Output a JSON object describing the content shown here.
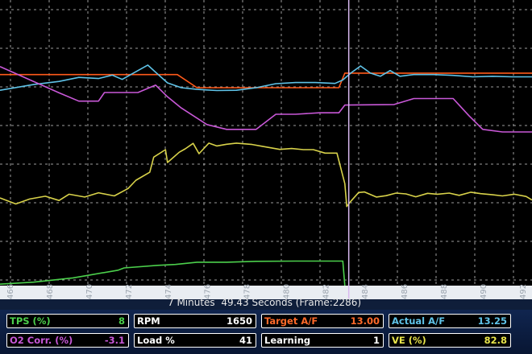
{
  "status": {
    "frame_text": "7 Minutes  49.43 Seconds (Frame:2286)"
  },
  "x_axis": {
    "ticks": [
      "466",
      "468",
      "470",
      "472",
      "474",
      "476",
      "478",
      "480",
      "482",
      "484",
      "486",
      "488",
      "490",
      "492"
    ]
  },
  "cursor": {
    "x": 483.2
  },
  "colors": {
    "background": "#000000",
    "grid": "#cfcfcf",
    "target_af": "#ff5a1a",
    "actual_af": "#5fc3e8",
    "rpm": "#c958d8",
    "load": "#d8d24a",
    "tps": "#4cd04c",
    "cursor": "#d9b9f0"
  },
  "gauges": {
    "rows": [
      [
        {
          "label": "TPS (%)",
          "value": "8",
          "color": "#4cd04c"
        },
        {
          "label": "RPM",
          "value": "1650",
          "color": "#ffffff"
        },
        {
          "label": "Target A/F",
          "value": "13.00",
          "color": "#ff6a2a"
        },
        {
          "label": "Actual A/F",
          "value": "13.25",
          "color": "#5fc3e8"
        }
      ],
      [
        {
          "label": "O2 Corr. (%)",
          "value": "-3.1",
          "color": "#c958d8"
        },
        {
          "label": "Load %",
          "value": "41",
          "color": "#ffffff"
        },
        {
          "label": "Learning",
          "value": "1",
          "color": "#ffffff"
        },
        {
          "label": "VE (%)",
          "value": "82.8",
          "color": "#e8e44a"
        }
      ]
    ]
  },
  "chart_data": {
    "type": "line",
    "x_range": [
      465.5,
      492.5
    ],
    "y_range": [
      0,
      100
    ],
    "grid": true,
    "series": [
      {
        "key": "target_af",
        "color": "#ff5a1a",
        "points": [
          [
            465.5,
            73.9
          ],
          [
            474.5,
            73.9
          ],
          [
            475.5,
            69.3
          ],
          [
            482.7,
            69.3
          ],
          [
            483.0,
            74.4
          ],
          [
            492.5,
            74.4
          ]
        ]
      },
      {
        "key": "actual_af",
        "color": "#5fc3e8",
        "points": [
          [
            465.5,
            68.4
          ],
          [
            467.2,
            70.4
          ],
          [
            468.5,
            71.5
          ],
          [
            469.5,
            72.9
          ],
          [
            470.5,
            72.5
          ],
          [
            471.2,
            73.7
          ],
          [
            471.7,
            72.2
          ],
          [
            472.4,
            74.9
          ],
          [
            473.0,
            77.2
          ],
          [
            473.4,
            74.7
          ],
          [
            474.0,
            71.0
          ],
          [
            474.7,
            69.3
          ],
          [
            475.5,
            68.7
          ],
          [
            476.5,
            68.3
          ],
          [
            477.5,
            68.4
          ],
          [
            478.5,
            69.3
          ],
          [
            479.5,
            70.7
          ],
          [
            480.5,
            71.1
          ],
          [
            481.5,
            71.1
          ],
          [
            482.5,
            70.8
          ],
          [
            482.9,
            72.0
          ],
          [
            483.3,
            74.4
          ],
          [
            483.8,
            76.9
          ],
          [
            484.3,
            74.4
          ],
          [
            484.8,
            73.3
          ],
          [
            485.3,
            75.3
          ],
          [
            485.8,
            73.3
          ],
          [
            486.5,
            73.9
          ],
          [
            487.5,
            73.9
          ],
          [
            488.5,
            73.6
          ],
          [
            489.5,
            73.1
          ],
          [
            490.5,
            73.3
          ],
          [
            491.5,
            73.1
          ],
          [
            492.5,
            73.1
          ]
        ]
      },
      {
        "key": "rpm",
        "color": "#c958d8",
        "points": [
          [
            465.5,
            76.7
          ],
          [
            468.5,
            67.5
          ],
          [
            469.5,
            64.6
          ],
          [
            470.5,
            64.6
          ],
          [
            470.8,
            67.6
          ],
          [
            472.5,
            67.6
          ],
          [
            473.4,
            70.2
          ],
          [
            474.0,
            66.1
          ],
          [
            474.7,
            62.2
          ],
          [
            476.0,
            56.4
          ],
          [
            477.0,
            54.7
          ],
          [
            478.5,
            54.7
          ],
          [
            479.5,
            60.0
          ],
          [
            480.5,
            60.0
          ],
          [
            481.7,
            60.5
          ],
          [
            482.7,
            60.5
          ],
          [
            483.0,
            63.2
          ],
          [
            485.5,
            63.4
          ],
          [
            486.5,
            65.5
          ],
          [
            487.5,
            65.5
          ],
          [
            488.5,
            65.5
          ],
          [
            489.3,
            59.5
          ],
          [
            490.0,
            54.7
          ],
          [
            491.0,
            53.8
          ],
          [
            492.5,
            53.8
          ]
        ]
      },
      {
        "key": "load",
        "color": "#d8d24a",
        "points": [
          [
            465.5,
            30.7
          ],
          [
            466.3,
            28.6
          ],
          [
            467.0,
            30.3
          ],
          [
            467.8,
            31.3
          ],
          [
            468.5,
            29.8
          ],
          [
            469.0,
            32.0
          ],
          [
            469.8,
            31.0
          ],
          [
            470.5,
            32.5
          ],
          [
            471.3,
            31.4
          ],
          [
            472.0,
            34.0
          ],
          [
            472.4,
            36.9
          ],
          [
            473.1,
            39.7
          ],
          [
            473.3,
            45.0
          ],
          [
            473.9,
            47.6
          ],
          [
            474.0,
            43.1
          ],
          [
            474.6,
            46.7
          ],
          [
            474.9,
            47.9
          ],
          [
            475.3,
            49.8
          ],
          [
            475.6,
            46.2
          ],
          [
            476.1,
            49.9
          ],
          [
            476.5,
            48.9
          ],
          [
            477.0,
            49.5
          ],
          [
            477.5,
            49.9
          ],
          [
            478.3,
            49.4
          ],
          [
            478.8,
            48.8
          ],
          [
            479.7,
            47.7
          ],
          [
            480.3,
            48.0
          ],
          [
            480.9,
            47.6
          ],
          [
            481.4,
            47.6
          ],
          [
            482.0,
            46.4
          ],
          [
            482.6,
            46.4
          ],
          [
            483.0,
            35.7
          ],
          [
            483.1,
            27.7
          ],
          [
            483.3,
            29.5
          ],
          [
            483.7,
            32.6
          ],
          [
            484.0,
            32.8
          ],
          [
            484.6,
            31.0
          ],
          [
            485.1,
            31.5
          ],
          [
            485.6,
            32.4
          ],
          [
            486.1,
            32.1
          ],
          [
            486.6,
            31.1
          ],
          [
            487.2,
            32.3
          ],
          [
            487.7,
            32.0
          ],
          [
            488.3,
            32.4
          ],
          [
            488.8,
            31.6
          ],
          [
            489.4,
            32.7
          ],
          [
            489.9,
            32.2
          ],
          [
            490.5,
            31.8
          ],
          [
            491.0,
            31.4
          ],
          [
            491.6,
            32.0
          ],
          [
            492.2,
            31.2
          ],
          [
            492.5,
            30.0
          ]
        ]
      },
      {
        "key": "tps",
        "color": "#4cd04c",
        "points": [
          [
            465.5,
            0.5
          ],
          [
            467.2,
            1.2
          ],
          [
            469.2,
            2.7
          ],
          [
            469.8,
            3.4
          ],
          [
            471.5,
            5.4
          ],
          [
            471.8,
            6.2
          ],
          [
            473.5,
            7.1
          ],
          [
            474.4,
            7.4
          ],
          [
            475.5,
            8.2
          ],
          [
            477.0,
            8.2
          ],
          [
            478.5,
            8.5
          ],
          [
            480.5,
            8.6
          ],
          [
            482.9,
            8.6
          ],
          [
            483.0,
            0.0
          ]
        ]
      }
    ]
  }
}
